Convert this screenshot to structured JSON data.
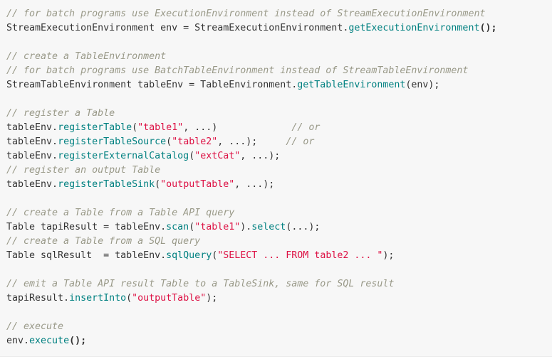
{
  "code_block": {
    "language": "java",
    "colors": {
      "background": "#f7f7f7",
      "comment": "#999988",
      "function": "#008080",
      "string": "#dd1144",
      "plain": "#333333"
    },
    "lines": [
      [
        {
          "t": "// for batch programs use ExecutionEnvironment instead of StreamExecutionEnvironment",
          "k": "comment"
        }
      ],
      [
        {
          "t": "StreamExecutionEnvironment env = StreamExecutionEnvironment.",
          "k": "plain"
        },
        {
          "t": "getExecutionEnvironment",
          "k": "fn"
        },
        {
          "t": "();",
          "k": "punct"
        }
      ],
      [],
      [
        {
          "t": "// create a TableEnvironment",
          "k": "comment"
        }
      ],
      [
        {
          "t": "// for batch programs use BatchTableEnvironment instead of StreamTableEnvironment",
          "k": "comment"
        }
      ],
      [
        {
          "t": "StreamTableEnvironment tableEnv = TableEnvironment.",
          "k": "plain"
        },
        {
          "t": "getTableEnvironment",
          "k": "fn"
        },
        {
          "t": "(env);",
          "k": "plain"
        }
      ],
      [],
      [
        {
          "t": "// register a Table",
          "k": "comment"
        }
      ],
      [
        {
          "t": "tableEnv.",
          "k": "plain"
        },
        {
          "t": "registerTable",
          "k": "fn"
        },
        {
          "t": "(",
          "k": "plain"
        },
        {
          "t": "\"table1\"",
          "k": "str"
        },
        {
          "t": ", ...)             ",
          "k": "plain"
        },
        {
          "t": "// or",
          "k": "comment"
        }
      ],
      [
        {
          "t": "tableEnv.",
          "k": "plain"
        },
        {
          "t": "registerTableSource",
          "k": "fn"
        },
        {
          "t": "(",
          "k": "plain"
        },
        {
          "t": "\"table2\"",
          "k": "str"
        },
        {
          "t": ", ...);     ",
          "k": "plain"
        },
        {
          "t": "// or",
          "k": "comment"
        }
      ],
      [
        {
          "t": "tableEnv.",
          "k": "plain"
        },
        {
          "t": "registerExternalCatalog",
          "k": "fn"
        },
        {
          "t": "(",
          "k": "plain"
        },
        {
          "t": "\"extCat\"",
          "k": "str"
        },
        {
          "t": ", ...);",
          "k": "plain"
        }
      ],
      [
        {
          "t": "// register an output Table",
          "k": "comment"
        }
      ],
      [
        {
          "t": "tableEnv.",
          "k": "plain"
        },
        {
          "t": "registerTableSink",
          "k": "fn"
        },
        {
          "t": "(",
          "k": "plain"
        },
        {
          "t": "\"outputTable\"",
          "k": "str"
        },
        {
          "t": ", ...);",
          "k": "plain"
        }
      ],
      [],
      [
        {
          "t": "// create a Table from a Table API query",
          "k": "comment"
        }
      ],
      [
        {
          "t": "Table tapiResult = tableEnv.",
          "k": "plain"
        },
        {
          "t": "scan",
          "k": "fn"
        },
        {
          "t": "(",
          "k": "plain"
        },
        {
          "t": "\"table1\"",
          "k": "str"
        },
        {
          "t": ").",
          "k": "plain"
        },
        {
          "t": "select",
          "k": "fn"
        },
        {
          "t": "(...);",
          "k": "plain"
        }
      ],
      [
        {
          "t": "// create a Table from a SQL query",
          "k": "comment"
        }
      ],
      [
        {
          "t": "Table sqlResult  = tableEnv.",
          "k": "plain"
        },
        {
          "t": "sqlQuery",
          "k": "fn"
        },
        {
          "t": "(",
          "k": "plain"
        },
        {
          "t": "\"SELECT ... FROM table2 ... \"",
          "k": "str"
        },
        {
          "t": ");",
          "k": "plain"
        }
      ],
      [],
      [
        {
          "t": "// emit a Table API result Table to a TableSink, same for SQL result",
          "k": "comment"
        }
      ],
      [
        {
          "t": "tapiResult.",
          "k": "plain"
        },
        {
          "t": "insertInto",
          "k": "fn"
        },
        {
          "t": "(",
          "k": "plain"
        },
        {
          "t": "\"outputTable\"",
          "k": "str"
        },
        {
          "t": ");",
          "k": "plain"
        }
      ],
      [],
      [
        {
          "t": "// execute",
          "k": "comment"
        }
      ],
      [
        {
          "t": "env.",
          "k": "plain"
        },
        {
          "t": "execute",
          "k": "fn"
        },
        {
          "t": "();",
          "k": "punct"
        }
      ]
    ]
  }
}
